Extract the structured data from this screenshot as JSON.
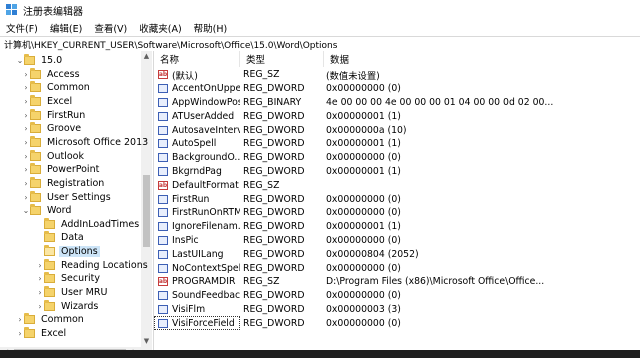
{
  "window": {
    "title": "注册表编辑器",
    "icon": "registry-editor-icon"
  },
  "menu": [
    "文件(F)",
    "编辑(E)",
    "查看(V)",
    "收藏夹(A)",
    "帮助(H)"
  ],
  "address": "计算机\\HKEY_CURRENT_USER\\Software\\Microsoft\\Office\\15.0\\Word\\Options",
  "tree": {
    "items": [
      {
        "label": "15.0",
        "chevron": "v",
        "level": 0
      },
      {
        "label": "Access",
        "chevron": ">",
        "level": 1
      },
      {
        "label": "Common",
        "chevron": ">",
        "level": 1
      },
      {
        "label": "Excel",
        "chevron": ">",
        "level": 1
      },
      {
        "label": "FirstRun",
        "chevron": ">",
        "level": 1
      },
      {
        "label": "Groove",
        "chevron": ">",
        "level": 1
      },
      {
        "label": "Microsoft Office 2013",
        "chevron": ">",
        "level": 1
      },
      {
        "label": "Outlook",
        "chevron": ">",
        "level": 1
      },
      {
        "label": "PowerPoint",
        "chevron": ">",
        "level": 1
      },
      {
        "label": "Registration",
        "chevron": ">",
        "level": 1
      },
      {
        "label": "User Settings",
        "chevron": ">",
        "level": 1
      },
      {
        "label": "Word",
        "chevron": "v",
        "level": 1
      },
      {
        "label": "AddInLoadTimes",
        "chevron": "",
        "level": 2
      },
      {
        "label": "Data",
        "chevron": "",
        "level": 2
      },
      {
        "label": "Options",
        "chevron": "",
        "level": 2,
        "selected": true
      },
      {
        "label": "Reading Locations",
        "chevron": ">",
        "level": 2
      },
      {
        "label": "Security",
        "chevron": ">",
        "level": 2
      },
      {
        "label": "User MRU",
        "chevron": ">",
        "level": 2
      },
      {
        "label": "Wizards",
        "chevron": ">",
        "level": 2
      },
      {
        "label": "Common",
        "chevron": ">",
        "level": 0
      },
      {
        "label": "Excel",
        "chevron": ">",
        "level": 0
      }
    ]
  },
  "columns": {
    "name": "名称",
    "type": "类型",
    "data": "数据"
  },
  "values": [
    {
      "icon": "ab",
      "name": "(默认)",
      "type": "REG_SZ",
      "data": "(数值未设置)"
    },
    {
      "icon": "dw",
      "name": "AccentOnUpper",
      "type": "REG_DWORD",
      "data": "0x00000000 (0)"
    },
    {
      "icon": "dw",
      "name": "AppWindowPos",
      "type": "REG_BINARY",
      "data": "4e 00 00 00 4e 00 00 00 01 04 00 00 0d 02 00..."
    },
    {
      "icon": "dw",
      "name": "ATUserAdded",
      "type": "REG_DWORD",
      "data": "0x00000001 (1)"
    },
    {
      "icon": "dw",
      "name": "AutosaveInterval",
      "type": "REG_DWORD",
      "data": "0x0000000a (10)"
    },
    {
      "icon": "dw",
      "name": "AutoSpell",
      "type": "REG_DWORD",
      "data": "0x00000001 (1)"
    },
    {
      "icon": "dw",
      "name": "BackgroundO...",
      "type": "REG_DWORD",
      "data": "0x00000000 (0)"
    },
    {
      "icon": "dw",
      "name": "BkgrndPag",
      "type": "REG_DWORD",
      "data": "0x00000001 (1)"
    },
    {
      "icon": "ab",
      "name": "DefaultFormat",
      "type": "REG_SZ",
      "data": ""
    },
    {
      "icon": "dw",
      "name": "FirstRun",
      "type": "REG_DWORD",
      "data": "0x00000000 (0)"
    },
    {
      "icon": "dw",
      "name": "FirstRunOnRTM",
      "type": "REG_DWORD",
      "data": "0x00000000 (0)"
    },
    {
      "icon": "dw",
      "name": "IgnoreFilenam...",
      "type": "REG_DWORD",
      "data": "0x00000001 (1)"
    },
    {
      "icon": "dw",
      "name": "InsPic",
      "type": "REG_DWORD",
      "data": "0x00000000 (0)"
    },
    {
      "icon": "dw",
      "name": "LastUILang",
      "type": "REG_DWORD",
      "data": "0x00000804 (2052)"
    },
    {
      "icon": "dw",
      "name": "NoContextSpell",
      "type": "REG_DWORD",
      "data": "0x00000000 (0)"
    },
    {
      "icon": "ab",
      "name": "PROGRAMDIR",
      "type": "REG_SZ",
      "data": "D:\\Program Files (x86)\\Microsoft Office\\Office..."
    },
    {
      "icon": "dw",
      "name": "SoundFeedback",
      "type": "REG_DWORD",
      "data": "0x00000000 (0)"
    },
    {
      "icon": "dw",
      "name": "VisiFlm",
      "type": "REG_DWORD",
      "data": "0x00000003 (3)"
    },
    {
      "icon": "dw",
      "name": "VisiForceField",
      "type": "REG_DWORD",
      "data": "0x00000000 (0)",
      "focused": true
    }
  ]
}
